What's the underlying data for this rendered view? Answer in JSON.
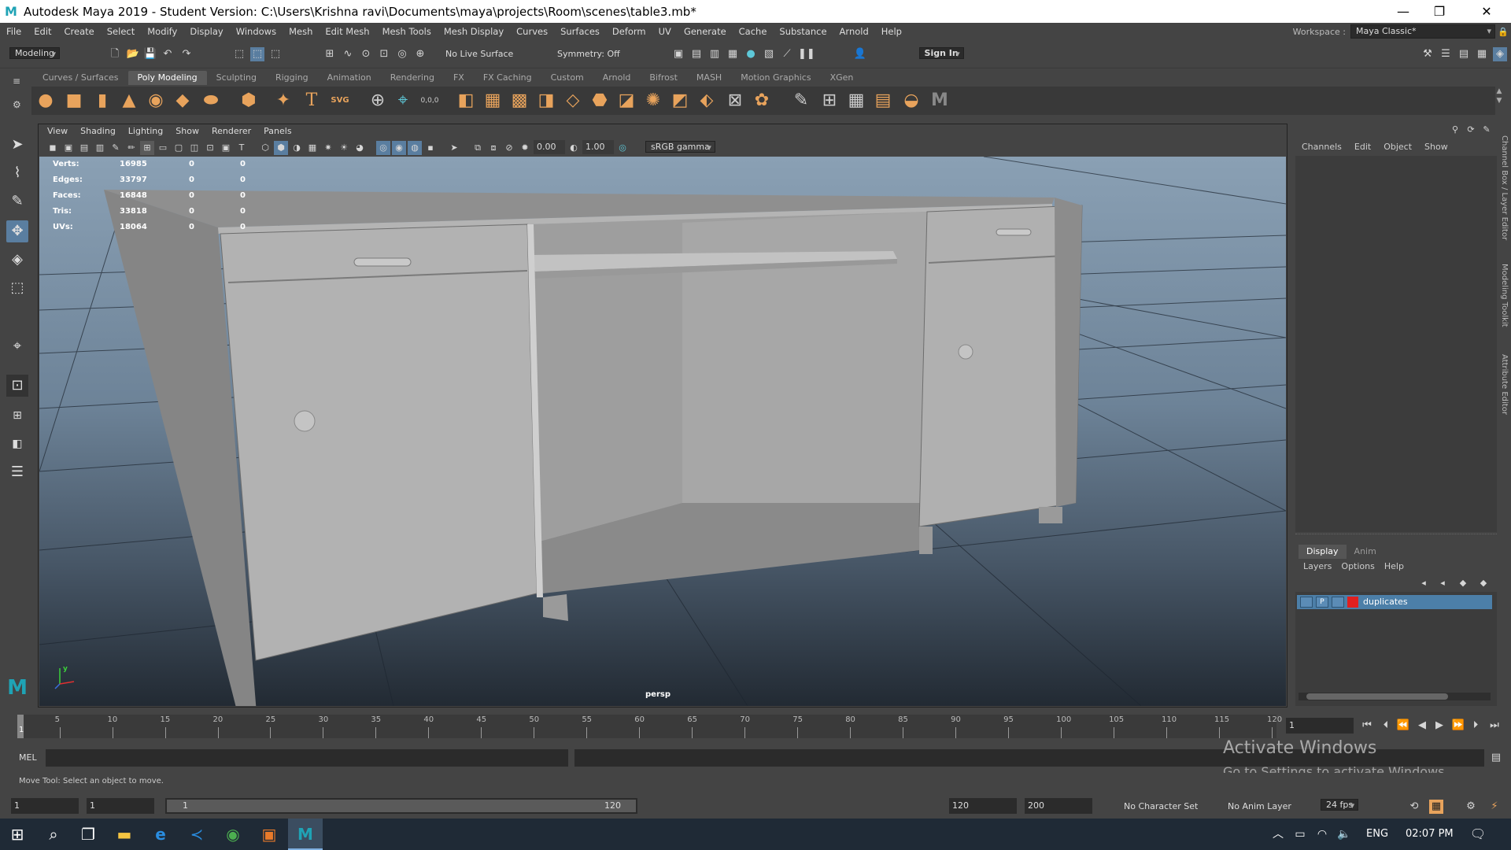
{
  "app": {
    "title": "Autodesk Maya 2019 - Student Version: C:\\Users\\Krishna ravi\\Documents\\maya\\projects\\Room\\scenes\\table3.mb*",
    "window_controls": [
      "—",
      "❐",
      "✕"
    ]
  },
  "menubar": {
    "items": [
      "File",
      "Edit",
      "Create",
      "Select",
      "Modify",
      "Display",
      "Windows",
      "Mesh",
      "Edit Mesh",
      "Mesh Tools",
      "Mesh Display",
      "Curves",
      "Surfaces",
      "Deform",
      "UV",
      "Generate",
      "Cache",
      "Substance",
      "Arnold",
      "Help"
    ],
    "workspace_label": "Workspace :",
    "workspace_value": "Maya Classic*"
  },
  "statusline": {
    "mode": "Modeling",
    "live_surface": "No Live Surface",
    "symmetry": "Symmetry: Off",
    "sign_in": "Sign In"
  },
  "shelf": {
    "tabs": [
      "Curves / Surfaces",
      "Poly Modeling",
      "Sculpting",
      "Rigging",
      "Animation",
      "Rendering",
      "FX",
      "FX Caching",
      "Custom",
      "Arnold",
      "Bifrost",
      "MASH",
      "Motion Graphics",
      "XGen"
    ],
    "active_tab": "Poly Modeling",
    "svg_label": "SVG",
    "text_label": "T",
    "coord_label": "0,0,0"
  },
  "viewport": {
    "menu": [
      "View",
      "Shading",
      "Lighting",
      "Show",
      "Renderer",
      "Panels"
    ],
    "exposure": "0.00",
    "gamma": "1.00",
    "colorspace": "sRGB gamma",
    "camera_label": "persp",
    "axis_label": "y",
    "hud": [
      {
        "label": "Verts:",
        "v1": "16985",
        "v2": "0",
        "v3": "0"
      },
      {
        "label": "Edges:",
        "v1": "33797",
        "v2": "0",
        "v3": "0"
      },
      {
        "label": "Faces:",
        "v1": "16848",
        "v2": "0",
        "v3": "0"
      },
      {
        "label": "Tris:",
        "v1": "33818",
        "v2": "0",
        "v3": "0"
      },
      {
        "label": "UVs:",
        "v1": "18064",
        "v2": "0",
        "v3": "0"
      }
    ]
  },
  "channelbox": {
    "menu": [
      "Channels",
      "Edit",
      "Object",
      "Show"
    ]
  },
  "layers": {
    "tabs": [
      "Display",
      "Anim"
    ],
    "active_tab": "Display",
    "menu": [
      "Layers",
      "Options",
      "Help"
    ],
    "rows": [
      {
        "v": "",
        "p": "P",
        "name": "duplicates",
        "color": "#e02020"
      }
    ]
  },
  "side_tabs": [
    "Channel Box / Layer Editor",
    "Modeling Toolkit",
    "Attribute Editor"
  ],
  "timeline": {
    "ticks": [
      "5",
      "10",
      "15",
      "20",
      "25",
      "30",
      "35",
      "40",
      "45",
      "50",
      "55",
      "60",
      "65",
      "70",
      "75",
      "80",
      "85",
      "90",
      "95",
      "100",
      "105",
      "110",
      "115",
      "120"
    ],
    "first_frame_label": "1",
    "current_frame": "1"
  },
  "cmdline": {
    "label": "MEL"
  },
  "helpline": {
    "text": "Move Tool: Select an object to move."
  },
  "activate_windows": {
    "title": "Activate Windows",
    "subtitle": "Go to Settings to activate Windows."
  },
  "range": {
    "start": "1",
    "playback_start": "1",
    "slider_left": "1",
    "slider_right": "120",
    "playback_end": "120",
    "end": "200",
    "character_set": "No Character Set",
    "anim_layer": "No Anim Layer",
    "fps": "24 fps"
  },
  "taskbar": {
    "lang": "ENG",
    "time": "02:07 PM"
  },
  "colors": {
    "layer_highlight": "#4c7fa8",
    "accent": "#e8a35c"
  }
}
